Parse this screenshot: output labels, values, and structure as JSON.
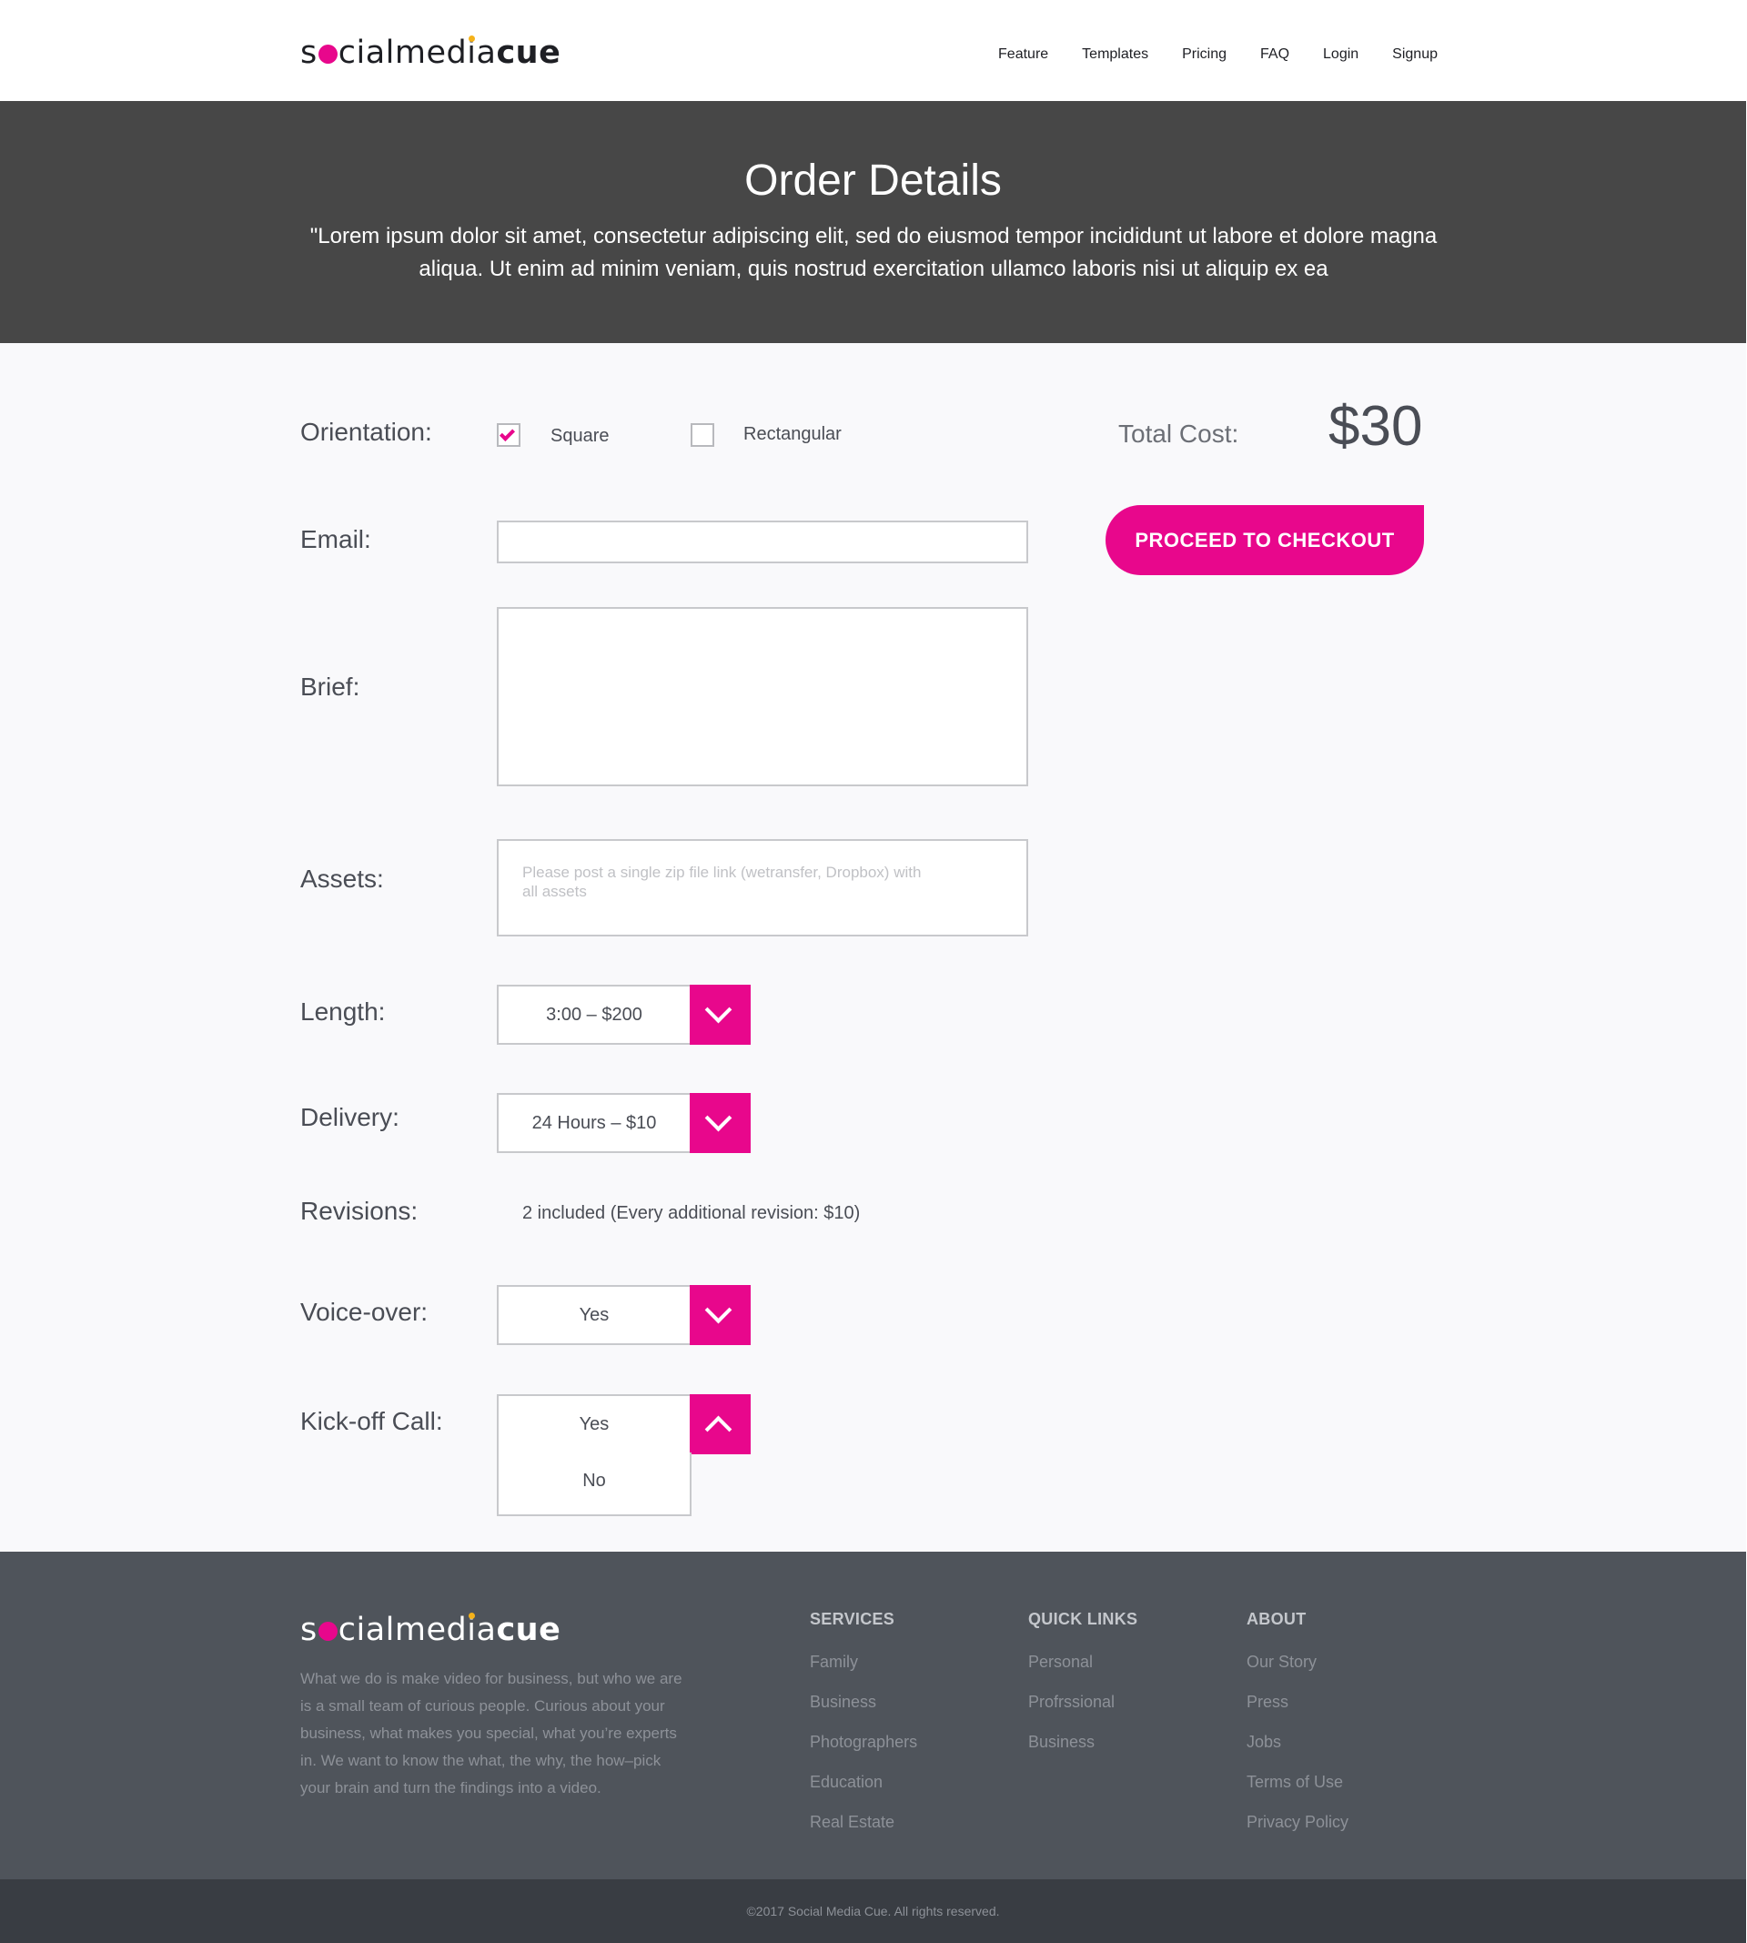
{
  "header": {
    "logo": {
      "s": "s",
      "ial": "cial",
      "media_pre": "med",
      "i": "i",
      "a": "a",
      "cue": "cue"
    },
    "nav": [
      "Feature",
      "Templates",
      "Pricing",
      "FAQ",
      "Login",
      "Signup"
    ]
  },
  "hero": {
    "title": "Order Details",
    "subtitle": "\"Lorem ipsum dolor sit amet, consectetur adipiscing elit, sed do eiusmod tempor incididunt ut labore et dolore magna aliqua. Ut enim ad minim veniam, quis nostrud exercitation ullamco laboris nisi ut aliquip ex ea"
  },
  "form": {
    "orientation": {
      "label": "Orientation:",
      "options": [
        {
          "label": "Square",
          "checked": true
        },
        {
          "label": "Rectangular",
          "checked": false
        }
      ]
    },
    "email": {
      "label": "Email:",
      "value": ""
    },
    "brief": {
      "label": "Brief:",
      "value": ""
    },
    "assets": {
      "label": "Assets:",
      "placeholder": "Please post a single zip file link (wetransfer, Dropbox) with all assets"
    },
    "length": {
      "label": "Length:",
      "value": "3:00 – $200"
    },
    "delivery": {
      "label": "Delivery:",
      "value": "24 Hours – $10"
    },
    "revisions": {
      "label": "Revisions:",
      "value": "2 included (Every additional revision: $10)"
    },
    "voiceover": {
      "label": "Voice-over:",
      "value": "Yes"
    },
    "kickoff": {
      "label": "Kick-off Call:",
      "value": "Yes",
      "options": [
        "No"
      ]
    }
  },
  "summary": {
    "total_label": "Total Cost:",
    "total_value": "$30",
    "checkout_label": "PROCEED TO CHECKOUT"
  },
  "colors": {
    "accent": "#e8078c",
    "hero_bg": "#474747",
    "footer_bg": "#4f545b",
    "copyright_bg": "#393d43"
  },
  "footer": {
    "about": "What we do is make video for business, but who we are is a small team of curious people. Curious about your business, what makes you special, what you’re experts in. We want to know the what, the why, the how–pick your brain and turn the findings into a video.",
    "columns": [
      {
        "title": "SERVICES",
        "links": [
          "Family",
          "Business",
          "Photographers",
          "Education",
          "Real Estate"
        ]
      },
      {
        "title": "QUICK LINKS",
        "links": [
          "Personal",
          "Profrssional",
          "Business"
        ]
      },
      {
        "title": "ABOUT",
        "links": [
          "Our Story",
          "Press",
          "Jobs",
          "Terms of Use",
          "Privacy Policy"
        ]
      }
    ],
    "copyright": "©2017 Social Media Cue. All rights reserved."
  }
}
